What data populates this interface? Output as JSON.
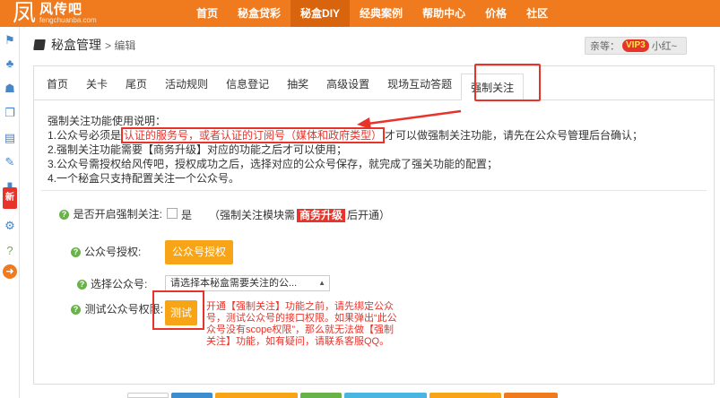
{
  "app": {
    "logo_mark": "凤",
    "logo_name": "风传吧",
    "logo_domain": "fengchuanba.com"
  },
  "nav": {
    "items": [
      {
        "label": "首页"
      },
      {
        "label": "秘盒贷彩"
      },
      {
        "label": "秘盒DIY",
        "active": true
      },
      {
        "label": "经典案例"
      },
      {
        "label": "帮助中心"
      },
      {
        "label": "价格"
      },
      {
        "label": "社区"
      }
    ]
  },
  "header": {
    "title": "秘盒管理",
    "breadcrumb": "> 编辑"
  },
  "user": {
    "prefix": "亲等：",
    "vip": "VIP3",
    "suffix": "小红~"
  },
  "tabs": [
    {
      "label": "首页"
    },
    {
      "label": "关卡"
    },
    {
      "label": "尾页"
    },
    {
      "label": "活动规则"
    },
    {
      "label": "信息登记"
    },
    {
      "label": "抽奖"
    },
    {
      "label": "高级设置"
    },
    {
      "label": "现场互动答题"
    },
    {
      "label": "强制关注",
      "active": true
    }
  ],
  "info": {
    "heading": "强制关注功能使用说明：",
    "line1_pre": "1.公众号必须是",
    "line1_hl": "认证的服务号，或者认证的订阅号（媒体和政府类型）",
    "line1_post": "才可以做强制关注功能，请先在公众号管理后台确认；",
    "line2": "2.强制关注功能需要【商务升级】对应的功能之后才可以使用；",
    "line3": "3.公众号需授权给风传吧，授权成功之后，选择对应的公众号保存，就完成了强关功能的配置；",
    "line4": "4.一个秘盒只支持配置关注一个公众号。"
  },
  "form": {
    "enable_label": "是否开启强制关注:",
    "enable_option": "是",
    "enable_note_pre": "（强制关注模块需",
    "enable_note_badge": "商务升级",
    "enable_note_post": "后开通）",
    "auth_label": "公众号授权:",
    "auth_button": "公众号授权",
    "select_label": "选择公众号:",
    "select_value": "请选择本秘盒需要关注的公...",
    "test_label": "测试公众号权限:",
    "test_button": "测试",
    "test_note": "开通【强制关注】功能之前，请先绑定公众号，测试公众号的接口权限。如果弹出“此公众号没有scope权限”，那么就无法做【强制关注】功能，如有疑问，请联系客服QQ。"
  },
  "colors": {
    "brand": "#f07b1e",
    "highlight": "#e8332a",
    "button": "#f7a416",
    "help": "#69b24a"
  },
  "sidebar": {
    "icons": [
      "flag-icon",
      "tree-icon",
      "people-icon",
      "window-icon",
      "film-icon",
      "tag-icon",
      "briefcase-icon",
      "gears-icon",
      "question-icon",
      "arrow-circle-icon"
    ],
    "badge": "新"
  }
}
